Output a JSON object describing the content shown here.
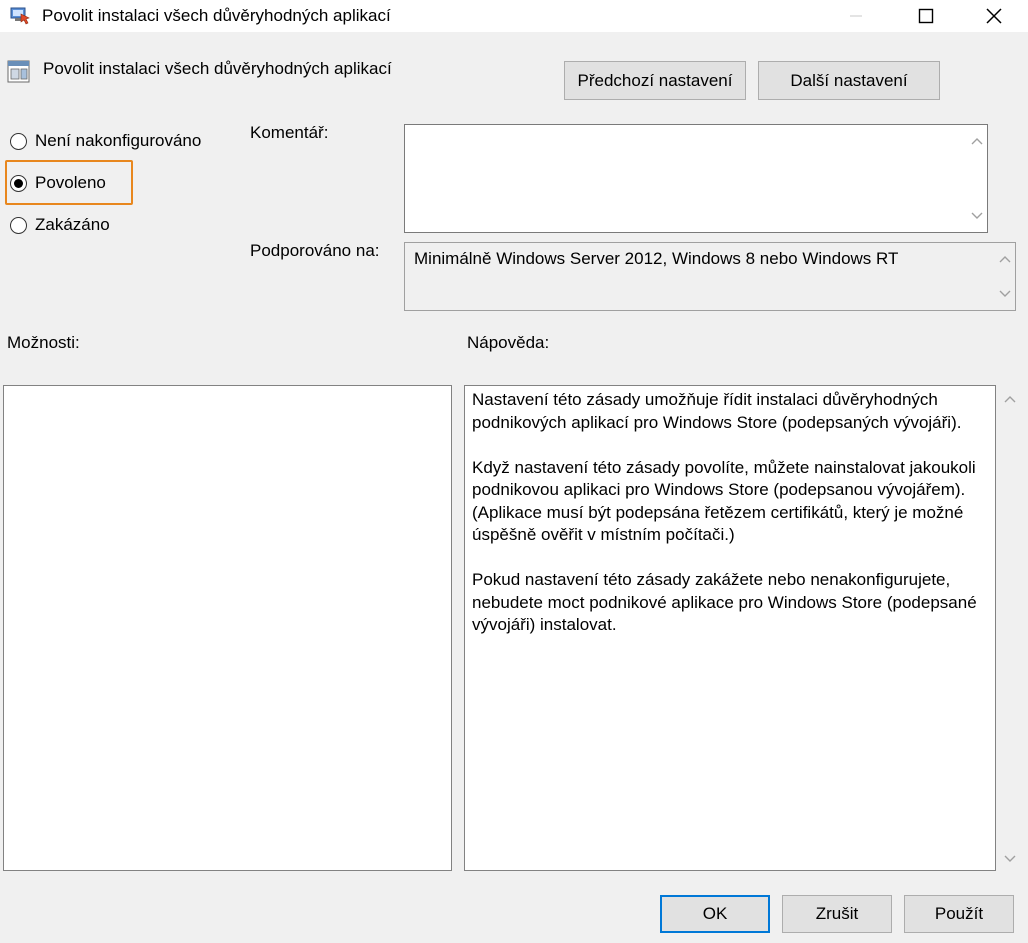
{
  "window": {
    "title": "Povolit instalaci všech důvěryhodných aplikací"
  },
  "header": {
    "policy_title": "Povolit instalaci všech důvěryhodných aplikací",
    "prev_button": "Předchozí nastavení",
    "next_button": "Další nastavení"
  },
  "state": {
    "options": [
      {
        "label": "Není nakonfigurováno",
        "checked": false
      },
      {
        "label": "Povoleno",
        "checked": true
      },
      {
        "label": "Zakázáno",
        "checked": false
      }
    ]
  },
  "comment": {
    "label": "Komentář:",
    "value": ""
  },
  "supported": {
    "label": "Podporováno na:",
    "value": "Minimálně Windows Server 2012, Windows 8 nebo Windows RT"
  },
  "options_panel": {
    "label": "Možnosti:"
  },
  "help_panel": {
    "label": "Nápověda:",
    "paragraphs": [
      "Nastavení této zásady umožňuje řídit instalaci důvěryhodných podnikových aplikací pro Windows Store (podepsaných vývojáři).",
      "Když nastavení této zásady povolíte, můžete nainstalovat jakoukoli podnikovou aplikaci pro Windows Store (podepsanou vývojářem). (Aplikace musí být podepsána řetězem certifikátů, který je možné úspěšně ověřit v místním počítači.)",
      "Pokud nastavení této zásady zakážete nebo nenakonfigurujete, nebudete moct podnikové aplikace pro Windows Store (podepsané vývojáři) instalovat."
    ]
  },
  "footer": {
    "ok": "OK",
    "cancel": "Zrušit",
    "apply": "Použít"
  },
  "colors": {
    "focus_outline": "#e8871e",
    "ok_border": "#0078d7"
  }
}
